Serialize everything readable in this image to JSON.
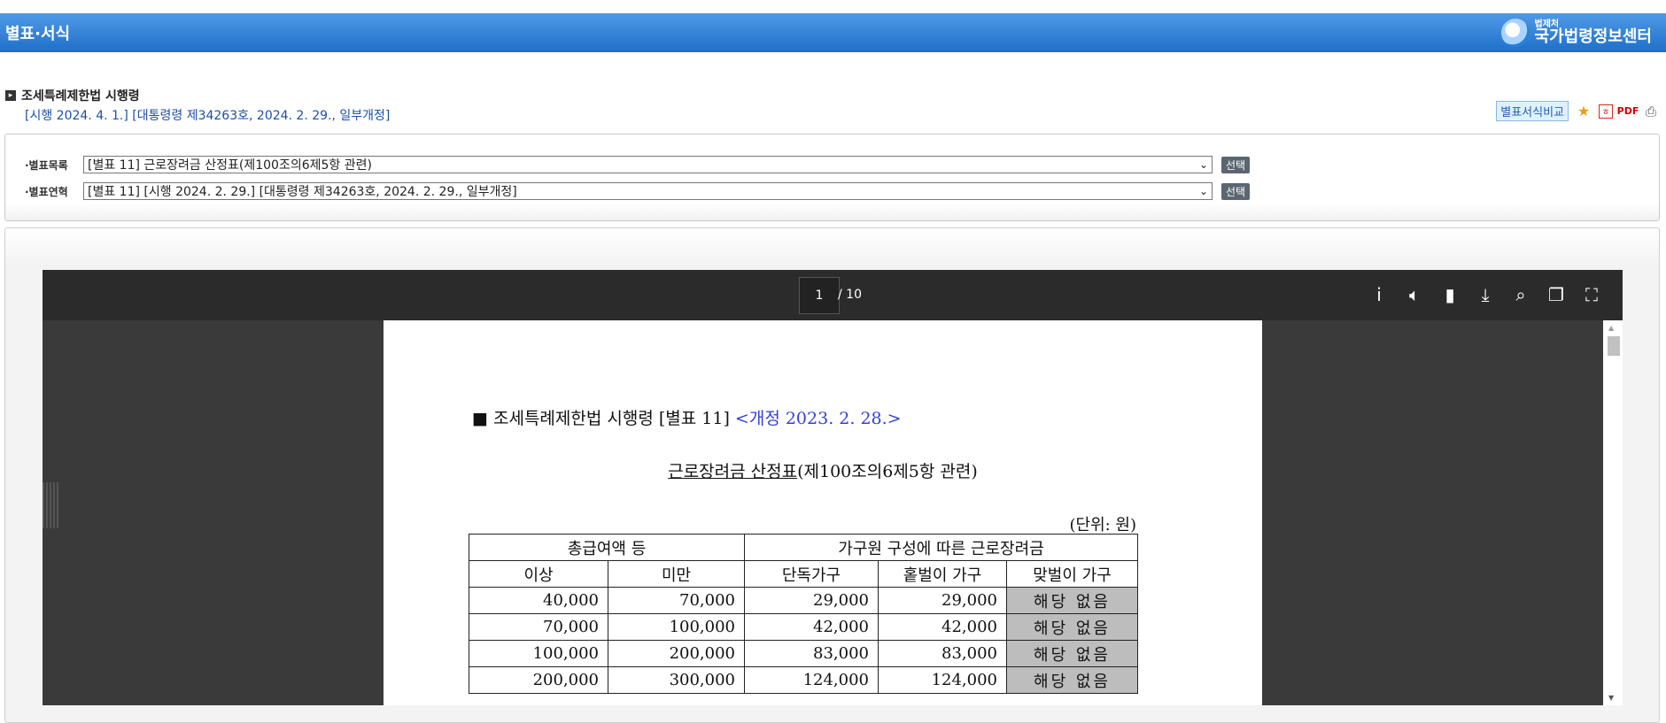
{
  "header": {
    "title": "별표·서식",
    "logo_small": "법제처",
    "logo_big": "국가법령정보센터"
  },
  "law": {
    "name": "조세특례제한법 시행령",
    "meta": "[시행 2024. 4. 1.] [대통령령 제34263호, 2024. 2. 29., 일부개정]"
  },
  "tools": {
    "compare_label": "별표서식비교"
  },
  "selectors": {
    "list_label": "·별표목록",
    "list_value": "[별표 11] 근로장려금 산정표(제100조의6제5항 관련)",
    "history_label": "·별표연혁",
    "history_value": "[별표 11] [시행 2024. 2. 29.] [대통령령 제34263호, 2024. 2. 29., 일부개정]",
    "button_label": "선택"
  },
  "viewer": {
    "current_page": "1",
    "page_total": "/ 10"
  },
  "document": {
    "heading": "■ 조세특례제한법 시행령 [별표 11] ",
    "amend": "<개정 2023. 2. 28.>",
    "subtitle_underlined": "근로장려금 산정표",
    "subtitle_rest": "(제100조의6제5항 관련)",
    "unit": "(단위: 원)",
    "table": {
      "header1": [
        "총급여액 등",
        "가구원 구성에 따른 근로장려금"
      ],
      "header2": [
        "이상",
        "미만",
        "단독가구",
        "홑벌이 가구",
        "맞벌이 가구"
      ],
      "rows": [
        [
          "40,000",
          "70,000",
          "29,000",
          "29,000",
          "해당 없음"
        ],
        [
          "70,000",
          "100,000",
          "42,000",
          "42,000",
          "해당 없음"
        ],
        [
          "100,000",
          "200,000",
          "83,000",
          "83,000",
          "해당 없음"
        ],
        [
          "200,000",
          "300,000",
          "124,000",
          "124,000",
          "해당 없음"
        ]
      ]
    }
  }
}
